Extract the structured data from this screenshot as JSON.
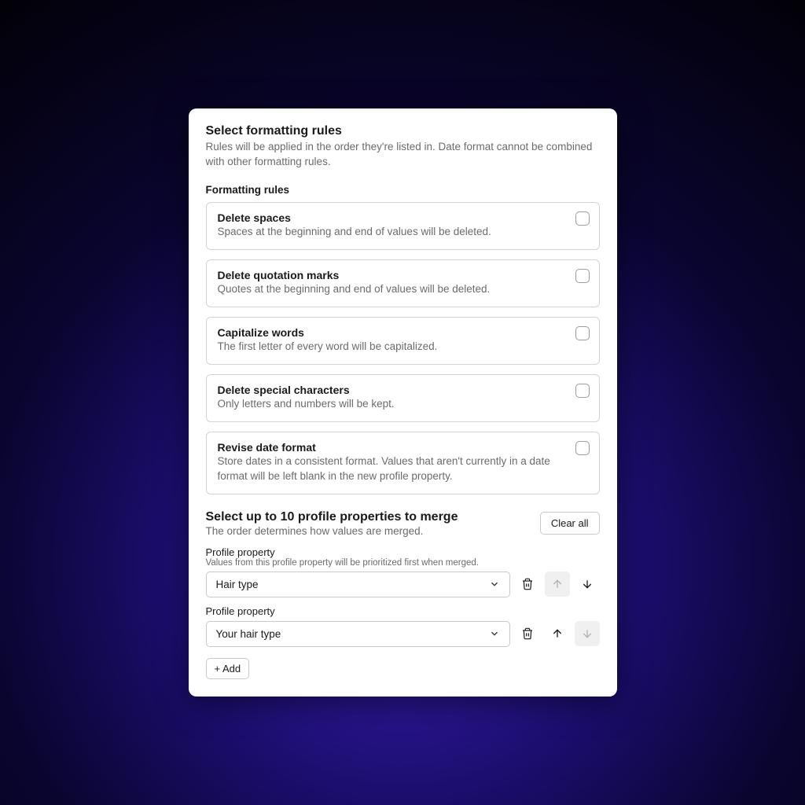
{
  "formatting": {
    "title": "Select formatting rules",
    "description": "Rules will be applied in the order they're listed in. Date format cannot be combined with other formatting rules.",
    "subheading": "Formatting rules",
    "rules": [
      {
        "title": "Delete spaces",
        "desc": "Spaces at the beginning and end of values will be deleted."
      },
      {
        "title": "Delete quotation marks",
        "desc": "Quotes at the beginning and end of values will be deleted."
      },
      {
        "title": "Capitalize words",
        "desc": "The first letter of every word will be capitalized."
      },
      {
        "title": "Delete special characters",
        "desc": "Only letters and numbers will be kept."
      },
      {
        "title": "Revise date format",
        "desc": "Store dates in a consistent format. Values that aren't currently in a date format will be left blank in the new profile property."
      }
    ]
  },
  "merge": {
    "title": "Select up to 10 profile properties to merge",
    "description": "The order determines how values are merged.",
    "clear_label": "Clear all",
    "property_label": "Profile property",
    "priority_hint": "Values from this profile property will be prioritized first when merged.",
    "properties": [
      {
        "value": "Hair type"
      },
      {
        "value": "Your hair type"
      }
    ],
    "add_label": "+ Add"
  }
}
